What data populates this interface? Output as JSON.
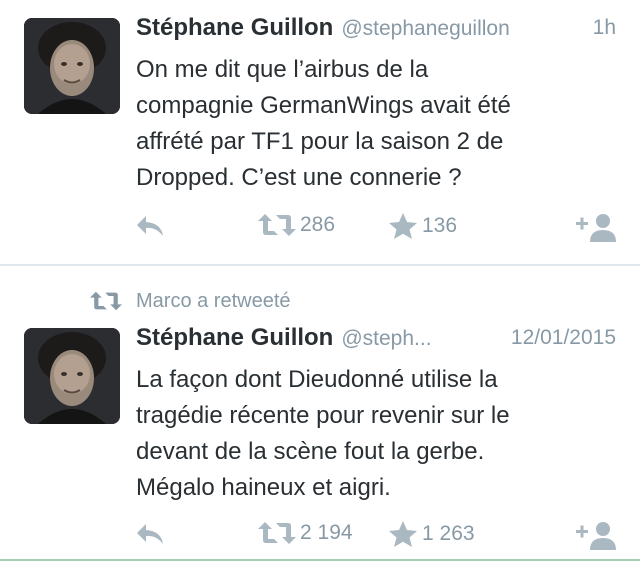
{
  "tweets": [
    {
      "author_name": "Stéphane Guillon",
      "author_handle": "@stephaneguillon",
      "time": "1h",
      "text_lines": [
        "On me dit que l’airbus de la",
        "compagnie GermanWings avait été",
        "affrété par TF1 pour la saison 2 de",
        "Dropped. C’est une connerie ?"
      ],
      "retweets": "286",
      "favorites": "136",
      "icons": {
        "reply": "reply-icon",
        "retweet": "retweet-icon",
        "favorite": "star-icon",
        "follow": "follow-icon"
      }
    },
    {
      "retweet_context": "Marco a retweeté",
      "author_name": "Stéphane Guillon",
      "author_handle": "@steph...",
      "time": "12/01/2015",
      "text_lines": [
        "La façon dont Dieudonné utilise la",
        "tragédie récente pour revenir sur le",
        "devant de la scène fout la gerbe.",
        "Mégalo haineux et aigri."
      ],
      "retweets": "2 194",
      "favorites": "1 263",
      "icons": {
        "reply": "reply-icon",
        "retweet": "retweet-icon",
        "favorite": "star-icon",
        "follow": "follow-icon"
      }
    }
  ],
  "colors": {
    "text": "#292f33",
    "muted": "#8899a6",
    "icon": "#aab8c2",
    "divider": "#e1e8ed"
  }
}
